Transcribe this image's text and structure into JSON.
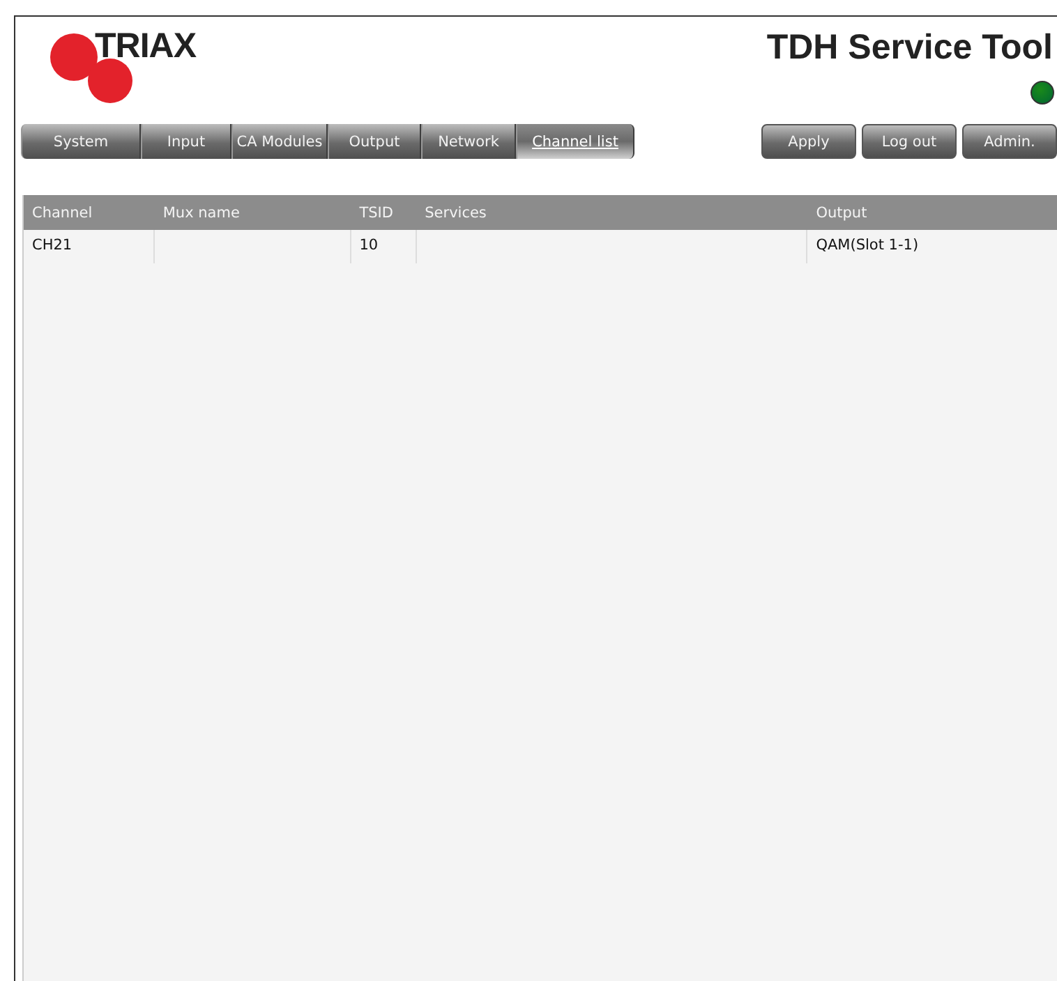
{
  "logo": {
    "text": "TRIAX"
  },
  "title": "TDH Service Tool",
  "status": {
    "on": true,
    "color": "#1a8a1a"
  },
  "tabs": [
    {
      "label": "System",
      "selected": false
    },
    {
      "label": "Input",
      "selected": false
    },
    {
      "label": "CA Modules",
      "selected": false
    },
    {
      "label": "Output",
      "selected": false
    },
    {
      "label": "Network",
      "selected": false
    },
    {
      "label": "Channel list",
      "selected": true
    }
  ],
  "buttons": [
    "Apply",
    "Log out",
    "Admin."
  ],
  "table": {
    "columns": [
      "Channel",
      "Mux name",
      "TSID",
      "Services",
      "Output"
    ],
    "rows": [
      {
        "channel": "CH21",
        "tsid": "10",
        "output": "QAM(Slot 1-1)"
      }
    ]
  }
}
